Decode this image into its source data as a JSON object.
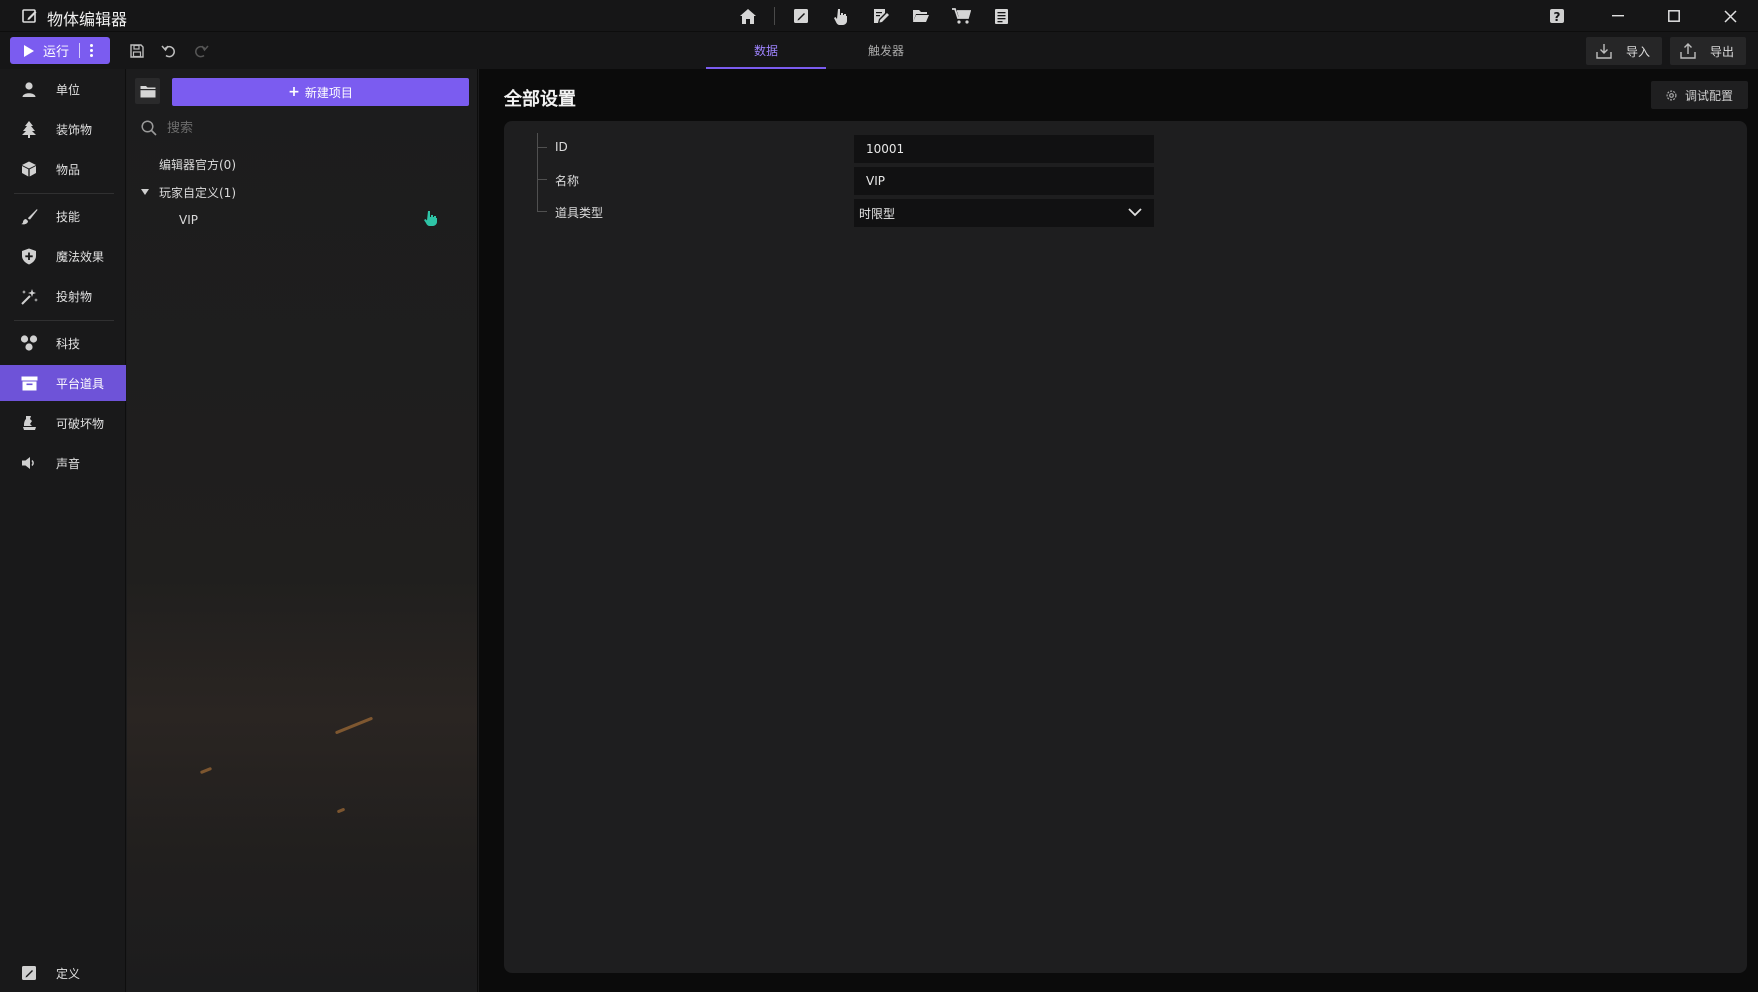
{
  "app": {
    "title": "物体编辑器",
    "icon": "edit-square-icon"
  },
  "titlebar": {
    "tool_icons": [
      "home-icon",
      "edit-square-icon",
      "pointer-hand-icon",
      "edit-note-icon",
      "folder-open-icon",
      "shopping-cart-icon",
      "clipboard-list-icon"
    ],
    "help_icon": "help-icon",
    "window_controls": [
      "minimize-icon",
      "maximize-icon",
      "close-icon"
    ]
  },
  "toolbar": {
    "run_label": "运行",
    "tabs": [
      {
        "label": "数据",
        "active": true
      },
      {
        "label": "触发器",
        "active": false
      }
    ],
    "import_label": "导入",
    "export_label": "导出"
  },
  "nav": {
    "items": [
      {
        "label": "单位",
        "icon": "person-icon"
      },
      {
        "label": "装饰物",
        "icon": "tree-icon"
      },
      {
        "label": "物品",
        "icon": "cube-icon"
      },
      {
        "label": "技能",
        "icon": "brush-icon"
      },
      {
        "label": "魔法效果",
        "icon": "shield-plus-icon"
      },
      {
        "label": "投射物",
        "icon": "sparkle-wand-icon"
      },
      {
        "label": "科技",
        "icon": "molecule-icon"
      },
      {
        "label": "平台道具",
        "icon": "archive-box-icon",
        "active": true
      },
      {
        "label": "可破坏物",
        "icon": "broken-pot-icon"
      },
      {
        "label": "声音",
        "icon": "speaker-icon"
      }
    ],
    "footer_label": "定义",
    "footer_icon": "edit-square-icon"
  },
  "tree": {
    "new_button_label": "新建项目",
    "search_placeholder": "搜索",
    "groups": [
      {
        "label": "编辑器官方(0)",
        "expanded": false
      },
      {
        "label": "玩家自定义(1)",
        "expanded": true,
        "children": [
          "VIP"
        ]
      }
    ]
  },
  "main": {
    "title": "全部设置",
    "debug_button_label": "调试配置",
    "properties": [
      {
        "label": "ID",
        "value": "10001"
      },
      {
        "label": "名称",
        "value": "VIP"
      },
      {
        "label": "道具类型",
        "value": "时限型",
        "type": "select"
      }
    ]
  },
  "colors": {
    "accent": "#7b5cf0",
    "background": "#1b1b1c",
    "card": "#1e1e1f",
    "input": "#111112"
  }
}
